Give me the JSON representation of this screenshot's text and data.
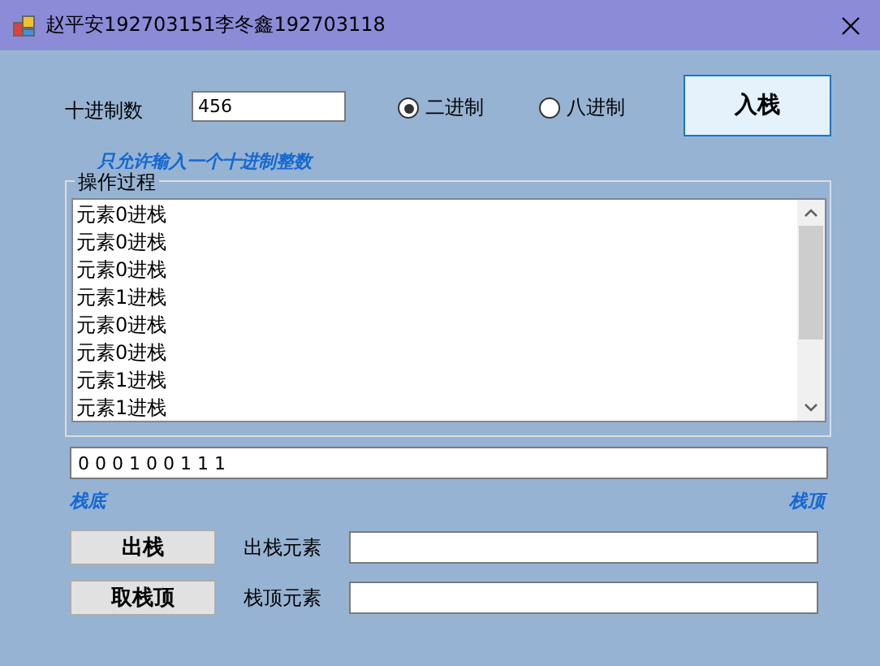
{
  "window": {
    "title": "赵平安192703151李冬鑫192703118"
  },
  "decimal_input": {
    "label": "十进制数",
    "value": "456",
    "hint": "只允许输入一个十进制整数"
  },
  "radios": [
    {
      "label": "二进制",
      "selected": true
    },
    {
      "label": "八进制",
      "selected": false
    }
  ],
  "push_button": "入栈",
  "log_group": {
    "title": "操作过程",
    "items": [
      "元素0进栈",
      "元素0进栈",
      "元素0进栈",
      "元素1进栈",
      "元素0进栈",
      "元素0进栈",
      "元素1进栈",
      "元素1进栈"
    ]
  },
  "stack_output": {
    "value": "0 0 0 1 0 0 1 1 1",
    "bottom_label": "栈底",
    "top_label": "栈顶"
  },
  "actions": [
    {
      "button": "出栈",
      "label": "出栈元素"
    },
    {
      "button": "取栈顶",
      "label": "栈顶元素"
    }
  ]
}
